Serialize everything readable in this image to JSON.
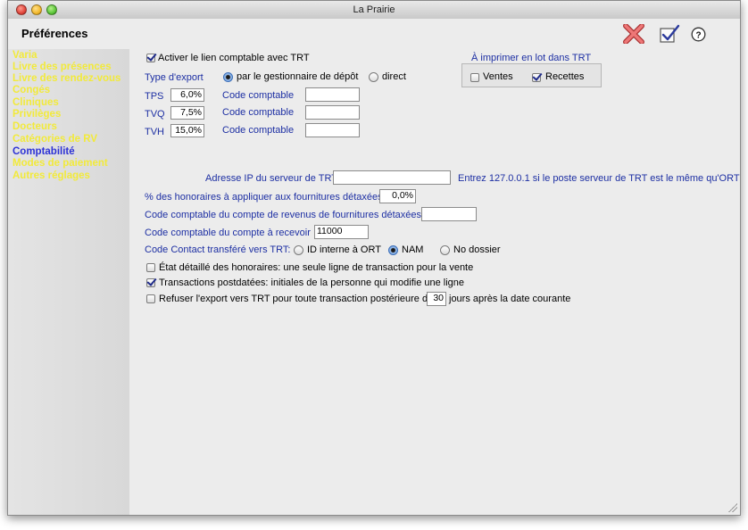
{
  "window": {
    "title": "La Prairie"
  },
  "header": {
    "title": "Préférences",
    "icons": [
      "cancel-x-icon",
      "checkmark-ok-icon",
      "help-icon"
    ],
    "help_glyph": "?"
  },
  "sidebar": {
    "items": [
      {
        "label": "Varia"
      },
      {
        "label": "Livre des présences"
      },
      {
        "label": "Livre des rendez-vous"
      },
      {
        "label": "Congés"
      },
      {
        "label": "Cliniques"
      },
      {
        "label": "Privilèges"
      },
      {
        "label": "Docteurs"
      },
      {
        "label": "Catégories de RV"
      },
      {
        "label": "Comptabilité",
        "active": true
      },
      {
        "label": "Modes de paiement"
      },
      {
        "label": "Autres réglages"
      }
    ],
    "item_color": "#f2ea3a",
    "active_color": "#2d32d6"
  },
  "compta": {
    "activer_label": "Activer le lien comptable avec TRT",
    "activer_checked": true,
    "type_export_label": "Type d'export",
    "option_gestionnaire": "par le gestionnaire de dépôt",
    "option_direct": "direct",
    "export_selected": "gestionnaire",
    "taxes": [
      {
        "name": "TPS",
        "rate": "6,0%",
        "code_label": "Code comptable",
        "code_value": ""
      },
      {
        "name": "TVQ",
        "rate": "7,5%",
        "code_label": "Code comptable",
        "code_value": ""
      },
      {
        "name": "TVH",
        "rate": "15,0%",
        "code_label": "Code comptable",
        "code_value": ""
      }
    ],
    "imprimer": {
      "title": "À imprimer en lot dans TRT",
      "ventes_label": "Ventes",
      "ventes_checked": false,
      "recettes_label": "Recettes",
      "recettes_checked": true
    },
    "ip_label": "Adresse IP du serveur de TRT",
    "ip_value": "",
    "ip_hint": "Entrez 127.0.0.1 si le poste serveur de TRT est le même qu'ORT",
    "pct_label": "% des honoraires à appliquer aux fournitures détaxées",
    "pct_value": "0,0%",
    "code_rev_label": "Code comptable du compte de revenus de fournitures détaxées",
    "code_rev_value": "",
    "code_recv_label": "Code comptable du compte à recevoir",
    "code_recv_value": "11000",
    "contact_label": "Code Contact transféré vers TRT:",
    "contact_options": [
      "ID interne à ORT",
      "NAM",
      "No dossier"
    ],
    "contact_selected": "NAM",
    "etat_label": "État détaillé des honoraires: une seule ligne de transaction pour la vente",
    "etat_checked": false,
    "postdatees_label": "Transactions postdatées: initiales de la personne qui modifie une ligne",
    "postdatees_checked": true,
    "refuser_label_before": "Refuser l'export vers TRT pour toute transaction postérieure de",
    "refuser_days": "30",
    "refuser_label_after": "jours après la date courante",
    "refuser_checked": false
  }
}
